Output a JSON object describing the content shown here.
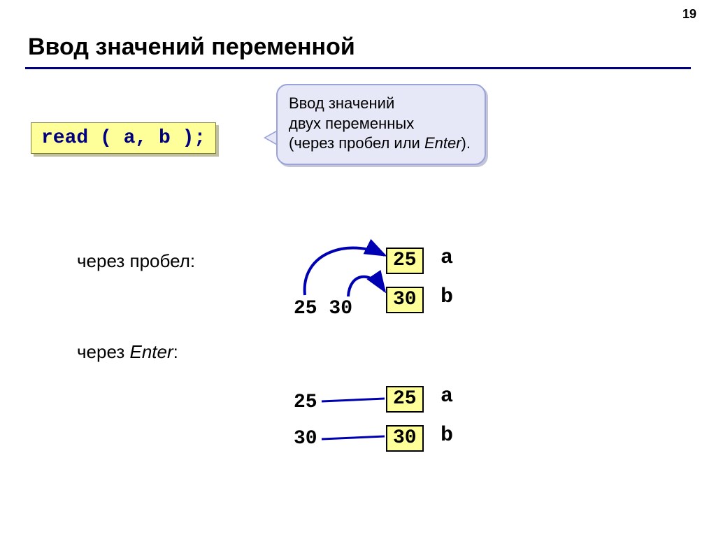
{
  "page_number": "19",
  "title": "Ввод значений переменной",
  "code": "read ( a, b );",
  "callout": {
    "line1": "Ввод значений",
    "line2": "двух переменных",
    "line3_prefix": "(через пробел или ",
    "line3_em": "Enter",
    "line3_suffix": ")."
  },
  "labels": {
    "space_label": "через пробел:",
    "enter_prefix": "через ",
    "enter_em": "Enter",
    "enter_suffix": ":"
  },
  "example_space": {
    "input": "25 30",
    "val_a": "25",
    "val_b": "30",
    "var_a": "a",
    "var_b": "b"
  },
  "example_enter": {
    "input1": "25",
    "input2": "30",
    "val_a": "25",
    "val_b": "30",
    "var_a": "a",
    "var_b": "b"
  }
}
